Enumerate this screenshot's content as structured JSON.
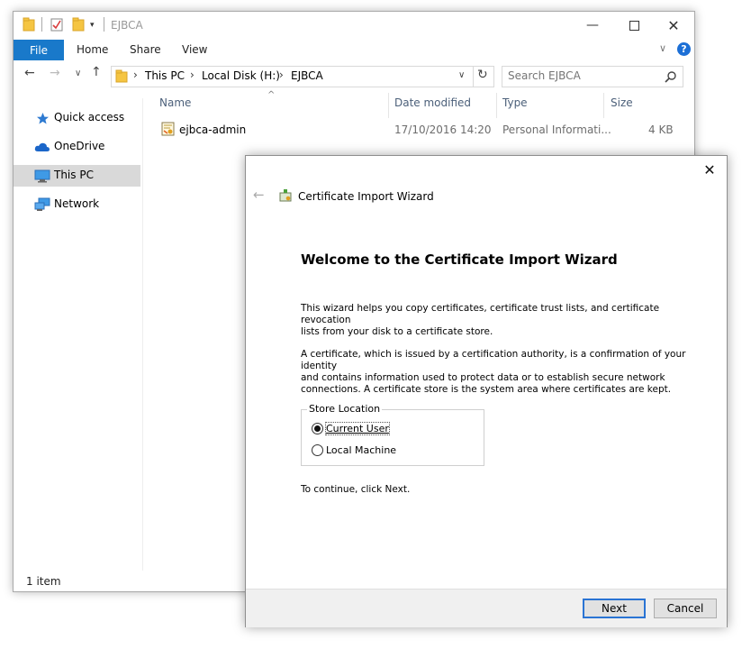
{
  "explorer": {
    "title": "EJBCA",
    "ribbon": {
      "file": "File",
      "home": "Home",
      "share": "Share",
      "view": "View",
      "help": "?"
    },
    "address": {
      "crumbs": [
        "This PC",
        "Local Disk (H:)",
        "EJBCA"
      ],
      "search_placeholder": "Search EJBCA"
    },
    "nav_pane": {
      "items": [
        {
          "label": "Quick access",
          "icon": "star-icon"
        },
        {
          "label": "OneDrive",
          "icon": "cloud-icon"
        },
        {
          "label": "This PC",
          "icon": "computer-icon",
          "selected": true
        },
        {
          "label": "Network",
          "icon": "network-icon"
        }
      ]
    },
    "columns": {
      "name": "Name",
      "date": "Date modified",
      "type": "Type",
      "size": "Size"
    },
    "rows": [
      {
        "name": "ejbca-admin",
        "date": "17/10/2016 14:20",
        "type": "Personal Informati...",
        "size": "4 KB"
      }
    ],
    "status": "1 item"
  },
  "wizard": {
    "window_title": "Certificate Import Wizard",
    "heading": "Welcome to the Certificate Import Wizard",
    "para1_line1": "This wizard helps you copy certificates, certificate trust lists, and certificate revocation",
    "para1_line2": "lists from your disk to a certificate store.",
    "para2_line1": "A certificate, which is issued by a certification authority, is a confirmation of your identity",
    "para2_line2": "and contains information used to protect data or to establish secure network",
    "para2_line3": "connections. A certificate store is the system area where certificates are kept.",
    "store_location": {
      "label": "Store Location",
      "options": [
        {
          "label": "Current User",
          "selected": true
        },
        {
          "label": "Local Machine",
          "selected": false
        }
      ]
    },
    "continue_text": "To continue, click Next.",
    "next_label": "Next",
    "cancel_label": "Cancel"
  },
  "colors": {
    "accent": "#1979ca",
    "selected_nav": "#d9d9d9",
    "folder": "#f5c542"
  }
}
